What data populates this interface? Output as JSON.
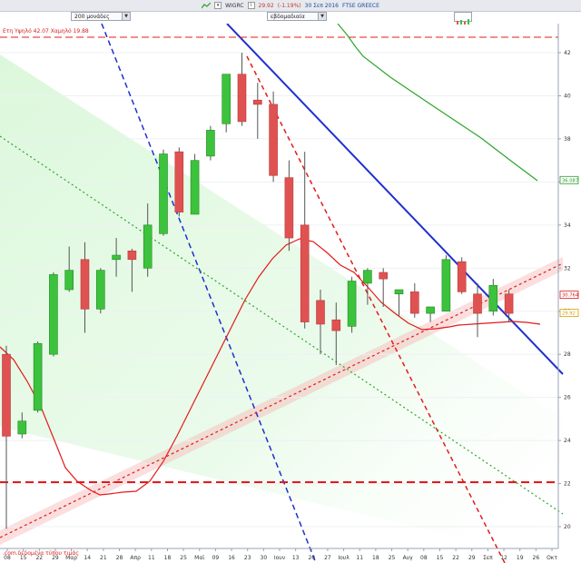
{
  "titlebar": {
    "symbol": "WIGRC",
    "price": "29.92",
    "change": "(-1.19%)",
    "date": "30 Σεπ 2016",
    "name": "FTSE GREECE"
  },
  "toolbar": {
    "range_value": "200 μονάδες",
    "period_value": "εβδομαδιαία"
  },
  "chart_data": {
    "type": "candlestick",
    "annotation": "Ετη Υψηλό 42.07 Χαμηλό 19.88",
    "watermark": ".com.δεδομένα τύπου τιμάς",
    "yticks": [
      20,
      22,
      24,
      26,
      28,
      30,
      32,
      34,
      36,
      38,
      40,
      42
    ],
    "ylim": [
      19.2,
      43.5
    ],
    "xticks": [
      "08",
      "15",
      "22",
      "29",
      "Μαρ",
      "14",
      "21",
      "28",
      "Απρ",
      "11",
      "18",
      "25",
      "Μαϊ",
      "09",
      "16",
      "23",
      "30",
      "Ιουν",
      "13",
      "20",
      "27",
      "Ιουλ",
      "11",
      "18",
      "25",
      "Αυγ",
      "08",
      "15",
      "22",
      "29",
      "Σεπ",
      "12",
      "19",
      "26",
      "Οκτ"
    ],
    "candles": [
      {
        "o": 28.0,
        "h": 28.4,
        "l": 19.9,
        "c": 24.2
      },
      {
        "o": 24.3,
        "h": 25.3,
        "l": 24.1,
        "c": 24.9
      },
      {
        "o": 25.4,
        "h": 28.6,
        "l": 25.3,
        "c": 28.5
      },
      {
        "o": 28.0,
        "h": 31.8,
        "l": 27.9,
        "c": 31.7
      },
      {
        "o": 31.0,
        "h": 33.0,
        "l": 30.9,
        "c": 31.9
      },
      {
        "o": 32.4,
        "h": 33.2,
        "l": 29.0,
        "c": 30.1
      },
      {
        "o": 30.1,
        "h": 32.0,
        "l": 29.9,
        "c": 31.9
      },
      {
        "o": 32.4,
        "h": 33.4,
        "l": 31.6,
        "c": 32.6
      },
      {
        "o": 32.8,
        "h": 32.9,
        "l": 30.9,
        "c": 32.4
      },
      {
        "o": 32.0,
        "h": 35.0,
        "l": 31.6,
        "c": 34.0
      },
      {
        "o": 33.6,
        "h": 37.5,
        "l": 33.5,
        "c": 37.3
      },
      {
        "o": 37.4,
        "h": 37.6,
        "l": 34.4,
        "c": 34.6
      },
      {
        "o": 34.5,
        "h": 37.3,
        "l": 34.5,
        "c": 37.0
      },
      {
        "o": 37.2,
        "h": 38.6,
        "l": 37.0,
        "c": 38.4
      },
      {
        "o": 38.7,
        "h": 41.0,
        "l": 38.3,
        "c": 41.0
      },
      {
        "o": 41.0,
        "h": 42.0,
        "l": 38.6,
        "c": 38.8
      },
      {
        "o": 39.8,
        "h": 40.6,
        "l": 38.0,
        "c": 39.6
      },
      {
        "o": 39.6,
        "h": 40.2,
        "l": 36.0,
        "c": 36.3
      },
      {
        "o": 36.2,
        "h": 37.0,
        "l": 32.8,
        "c": 33.4
      },
      {
        "o": 34.0,
        "h": 37.4,
        "l": 29.2,
        "c": 29.5
      },
      {
        "o": 30.5,
        "h": 31.0,
        "l": 28.0,
        "c": 29.4
      },
      {
        "o": 29.6,
        "h": 30.4,
        "l": 27.5,
        "c": 29.1
      },
      {
        "o": 29.3,
        "h": 31.6,
        "l": 29.0,
        "c": 31.4
      },
      {
        "o": 31.3,
        "h": 32.0,
        "l": 30.3,
        "c": 31.9
      },
      {
        "o": 31.8,
        "h": 32.0,
        "l": 30.2,
        "c": 31.5
      },
      {
        "o": 30.8,
        "h": 31.0,
        "l": 29.8,
        "c": 31.0
      },
      {
        "o": 30.9,
        "h": 31.3,
        "l": 29.7,
        "c": 29.9
      },
      {
        "o": 29.9,
        "h": 30.2,
        "l": 29.5,
        "c": 30.2
      },
      {
        "o": 30.0,
        "h": 32.6,
        "l": 30.0,
        "c": 32.4
      },
      {
        "o": 32.3,
        "h": 32.5,
        "l": 30.8,
        "c": 30.9
      },
      {
        "o": 30.8,
        "h": 31.3,
        "l": 28.8,
        "c": 29.9
      },
      {
        "o": 30.0,
        "h": 31.5,
        "l": 29.8,
        "c": 31.2
      },
      {
        "o": 30.8,
        "h": 31.0,
        "l": 29.5,
        "c": 29.9
      }
    ],
    "price_labels": [
      {
        "value": 36.087,
        "color": "#2e9b2e"
      },
      {
        "value": 30.764,
        "color": "#d62020"
      },
      {
        "value": 29.92,
        "color": "#d4a000"
      }
    ],
    "colors": {
      "up": "#3cc23c",
      "down": "#e05252",
      "ma_red": "#e41a1a",
      "ma_green": "#2aa52a",
      "trend_blue": "#1f2fd0"
    }
  }
}
